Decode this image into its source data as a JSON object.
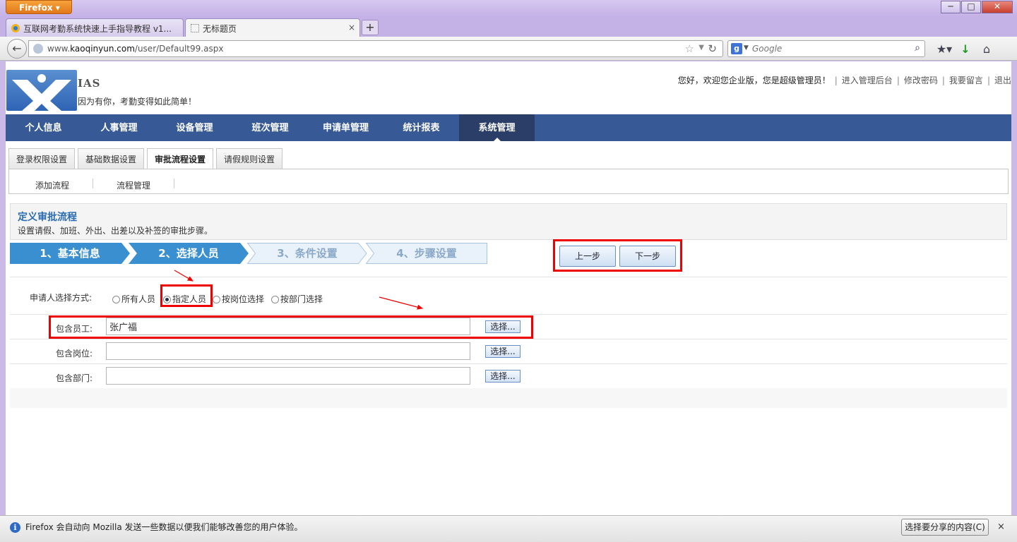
{
  "browser": {
    "app_button": "Firefox",
    "tabs": [
      {
        "title": "互联网考勤系统快速上手指导教程 v1...",
        "close": "×"
      },
      {
        "title": "无标题页",
        "close": "×"
      }
    ],
    "new_tab": "+",
    "url_host": "www.",
    "url_domain": "kaoqinyun.com",
    "url_path": "/user/Default99.aspx",
    "search_placeholder": "Google",
    "window_controls": [
      "─",
      "□",
      "✕"
    ]
  },
  "header": {
    "logo_text": "IAS",
    "slogan": "因为有你，考勤变得如此简单！",
    "greeting": "您好，欢迎您企业版，您是超级管理员！",
    "links": [
      "进入管理后台",
      "修改密码",
      "我要留言",
      "退出"
    ]
  },
  "main_nav": [
    "个人信息",
    "人事管理",
    "设备管理",
    "班次管理",
    "申请单管理",
    "统计报表",
    "系统管理"
  ],
  "sub_tabs": [
    "登录权限设置",
    "基础数据设置",
    "审批流程设置",
    "请假规则设置"
  ],
  "sub_links": [
    "添加流程",
    "流程管理"
  ],
  "section": {
    "title": "定义审批流程",
    "description": "设置请假、加班、外出、出差以及补签的审批步骤。"
  },
  "steps": [
    "1、基本信息",
    "2、选择人员",
    "3、条件设置",
    "4、步骤设置"
  ],
  "step_buttons": {
    "prev": "上一步",
    "next": "下一步"
  },
  "form": {
    "mode_label": "申请人选择方式:",
    "modes": [
      "所有人员",
      "指定人员",
      "按岗位选择",
      "按部门选择"
    ],
    "selected_mode": "指定人员",
    "employee_label": "包含员工:",
    "employee_value": "张广福",
    "position_label": "包含岗位:",
    "position_value": "",
    "dept_label": "包含部门:",
    "dept_value": "",
    "pick_label": "选择..."
  },
  "notification": {
    "message": "Firefox 会自动向 Mozilla 发送一些数据以便我们能够改善您的用户体验。",
    "share_button": "选择要分享的内容(C)",
    "close": "×"
  },
  "colors": {
    "nav_bg": "#375a97",
    "step_active": "#3a8fd0",
    "highlight_red": "#ee0000",
    "title_blue": "#2a6bb3"
  }
}
